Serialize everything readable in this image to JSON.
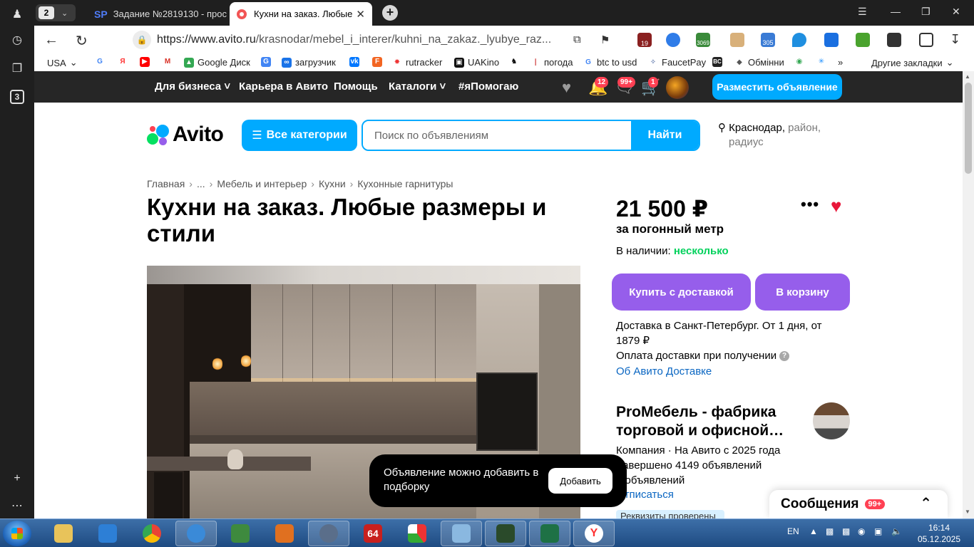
{
  "browser": {
    "tab_count": "2",
    "tabs": [
      {
        "label": "Задание №2819130 - прос",
        "favicon": "SP"
      },
      {
        "label": "Кухни на заказ. Любые",
        "close": "✕"
      }
    ],
    "url_domain": "https://www.avito.ru",
    "url_path": "/krasnodar/mebel_i_interer/kuhni_na_zakaz._lyubye_raz...",
    "bookmarks": [
      "USA",
      "Google Диск",
      "загрузчик",
      "rutracker",
      "UAKino",
      "погода",
      "btc to usd",
      "FaucetPay",
      "Обмінни",
      "Другие закладки"
    ],
    "rail_badge": "3",
    "ext_badges": [
      "19",
      "3069",
      "305"
    ]
  },
  "topbar": {
    "links": [
      "Для бизнеса",
      "Карьера в Авито",
      "Помощь",
      "Каталоги",
      "#яПомогаю"
    ],
    "counts": {
      "notifications": "12",
      "messages": "99+",
      "cart": "1"
    },
    "post_button": "Разместить объявление"
  },
  "header": {
    "logo_text": "Avito",
    "categories_button": "Все категории",
    "search_placeholder": "Поиск по объявлениям",
    "search_button": "Найти",
    "location_city": "Краснодар,",
    "location_hint_1": "район,",
    "location_hint_2": "радиус"
  },
  "breadcrumbs": [
    "Главная",
    "...",
    "Мебель и интерьер",
    "Кухни",
    "Кухонные гарнитуры"
  ],
  "listing": {
    "title": "Кухни на заказ. Любые размеры и стили",
    "price": "21 500 ₽",
    "unit": "за погонный метр",
    "stock_label": "В наличии: ",
    "stock_value": "несколько",
    "buy_button": "Купить с доставкой",
    "cart_button": "В корзину",
    "delivery_text": "Доставка в Санкт-Петербург. От 1 дня, от 1879 ₽",
    "payment_text": "Оплата доставки при получении",
    "delivery_link": "Об Авито Доставке"
  },
  "seller": {
    "name": "ProМебель - фабрика торговой и офисной…",
    "info_1": "Компания · На Авито с 2025 года",
    "info_2": "Завершено 4149 объявлений",
    "info_3": "4 объявлений",
    "unsubscribe": "Отписаться",
    "verified": "Реквизиты проверены"
  },
  "toast": {
    "text": "Объявление можно добавить в подборку",
    "button": "Добавить"
  },
  "messages_widget": {
    "label": "Сообщения",
    "count": "99+"
  },
  "taskbar": {
    "lang": "EN",
    "time": "16:14",
    "date": "05.12.2025",
    "app_label": "64"
  },
  "colors": {
    "avito_blue": "#00aaff",
    "avito_purple": "#965eeb",
    "avito_green": "#02d15c",
    "heart_red": "#e8173a",
    "topbar_dark": "#262626"
  }
}
